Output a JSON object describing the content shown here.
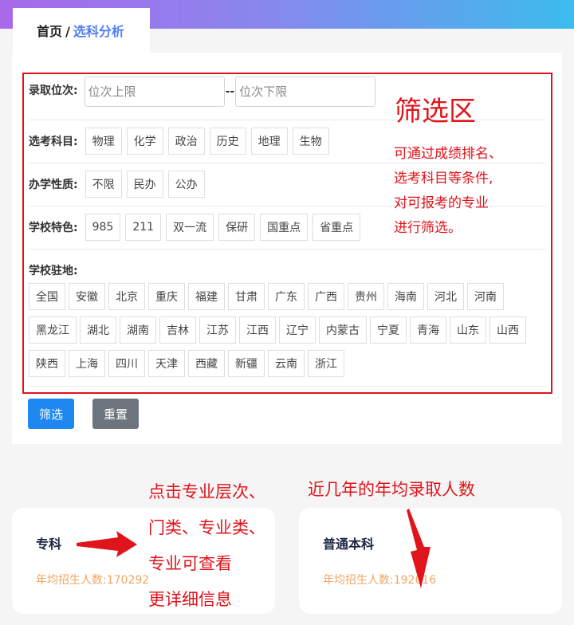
{
  "breadcrumb": {
    "home": "首页",
    "separator": "/",
    "current": "选科分析"
  },
  "filter": {
    "rank": {
      "label": "录取位次:",
      "upper_placeholder": "位次上限",
      "separator": "--",
      "lower_placeholder": "位次下限"
    },
    "subjects": {
      "label": "选考科目:",
      "options": [
        "物理",
        "化学",
        "政治",
        "历史",
        "地理",
        "生物"
      ]
    },
    "nature": {
      "label": "办学性质:",
      "options": [
        "不限",
        "民办",
        "公办"
      ]
    },
    "features": {
      "label": "学校特色:",
      "options": [
        "985",
        "211",
        "双一流",
        "保研",
        "国重点",
        "省重点"
      ]
    },
    "location": {
      "label": "学校驻地:",
      "options": [
        "全国",
        "安徽",
        "北京",
        "重庆",
        "福建",
        "甘肃",
        "广东",
        "广西",
        "贵州",
        "海南",
        "河北",
        "河南",
        "黑龙江",
        "湖北",
        "湖南",
        "吉林",
        "江苏",
        "江西",
        "辽宁",
        "内蒙古",
        "宁夏",
        "青海",
        "山东",
        "山西",
        "陕西",
        "上海",
        "四川",
        "天津",
        "西藏",
        "新疆",
        "云南",
        "浙江"
      ]
    },
    "submit_label": "筛选",
    "reset_label": "重置"
  },
  "annotations": {
    "filter_title": "筛选区",
    "filter_desc": [
      "可通过成绩排名、",
      "选考科目等条件,",
      "对可报考的专业",
      "进行筛选。"
    ],
    "click_hint": [
      "点击专业层次、",
      "门类、专业类、",
      "专业可查看",
      "更详细信息"
    ],
    "avg_hint": "近几年的年均录取人数"
  },
  "cards": [
    {
      "title": "专科",
      "stat_label": "年均招生人数:",
      "stat_value": "170292"
    },
    {
      "title": "普通本科",
      "stat_label": "年均招生人数:",
      "stat_value": "192016"
    }
  ],
  "colors": {
    "accent": "#e0141b",
    "primary_button": "#1e88f0",
    "secondary_button": "#6c757d",
    "stat": "#f0a562",
    "breadcrumb_current": "#4f7ff3"
  }
}
